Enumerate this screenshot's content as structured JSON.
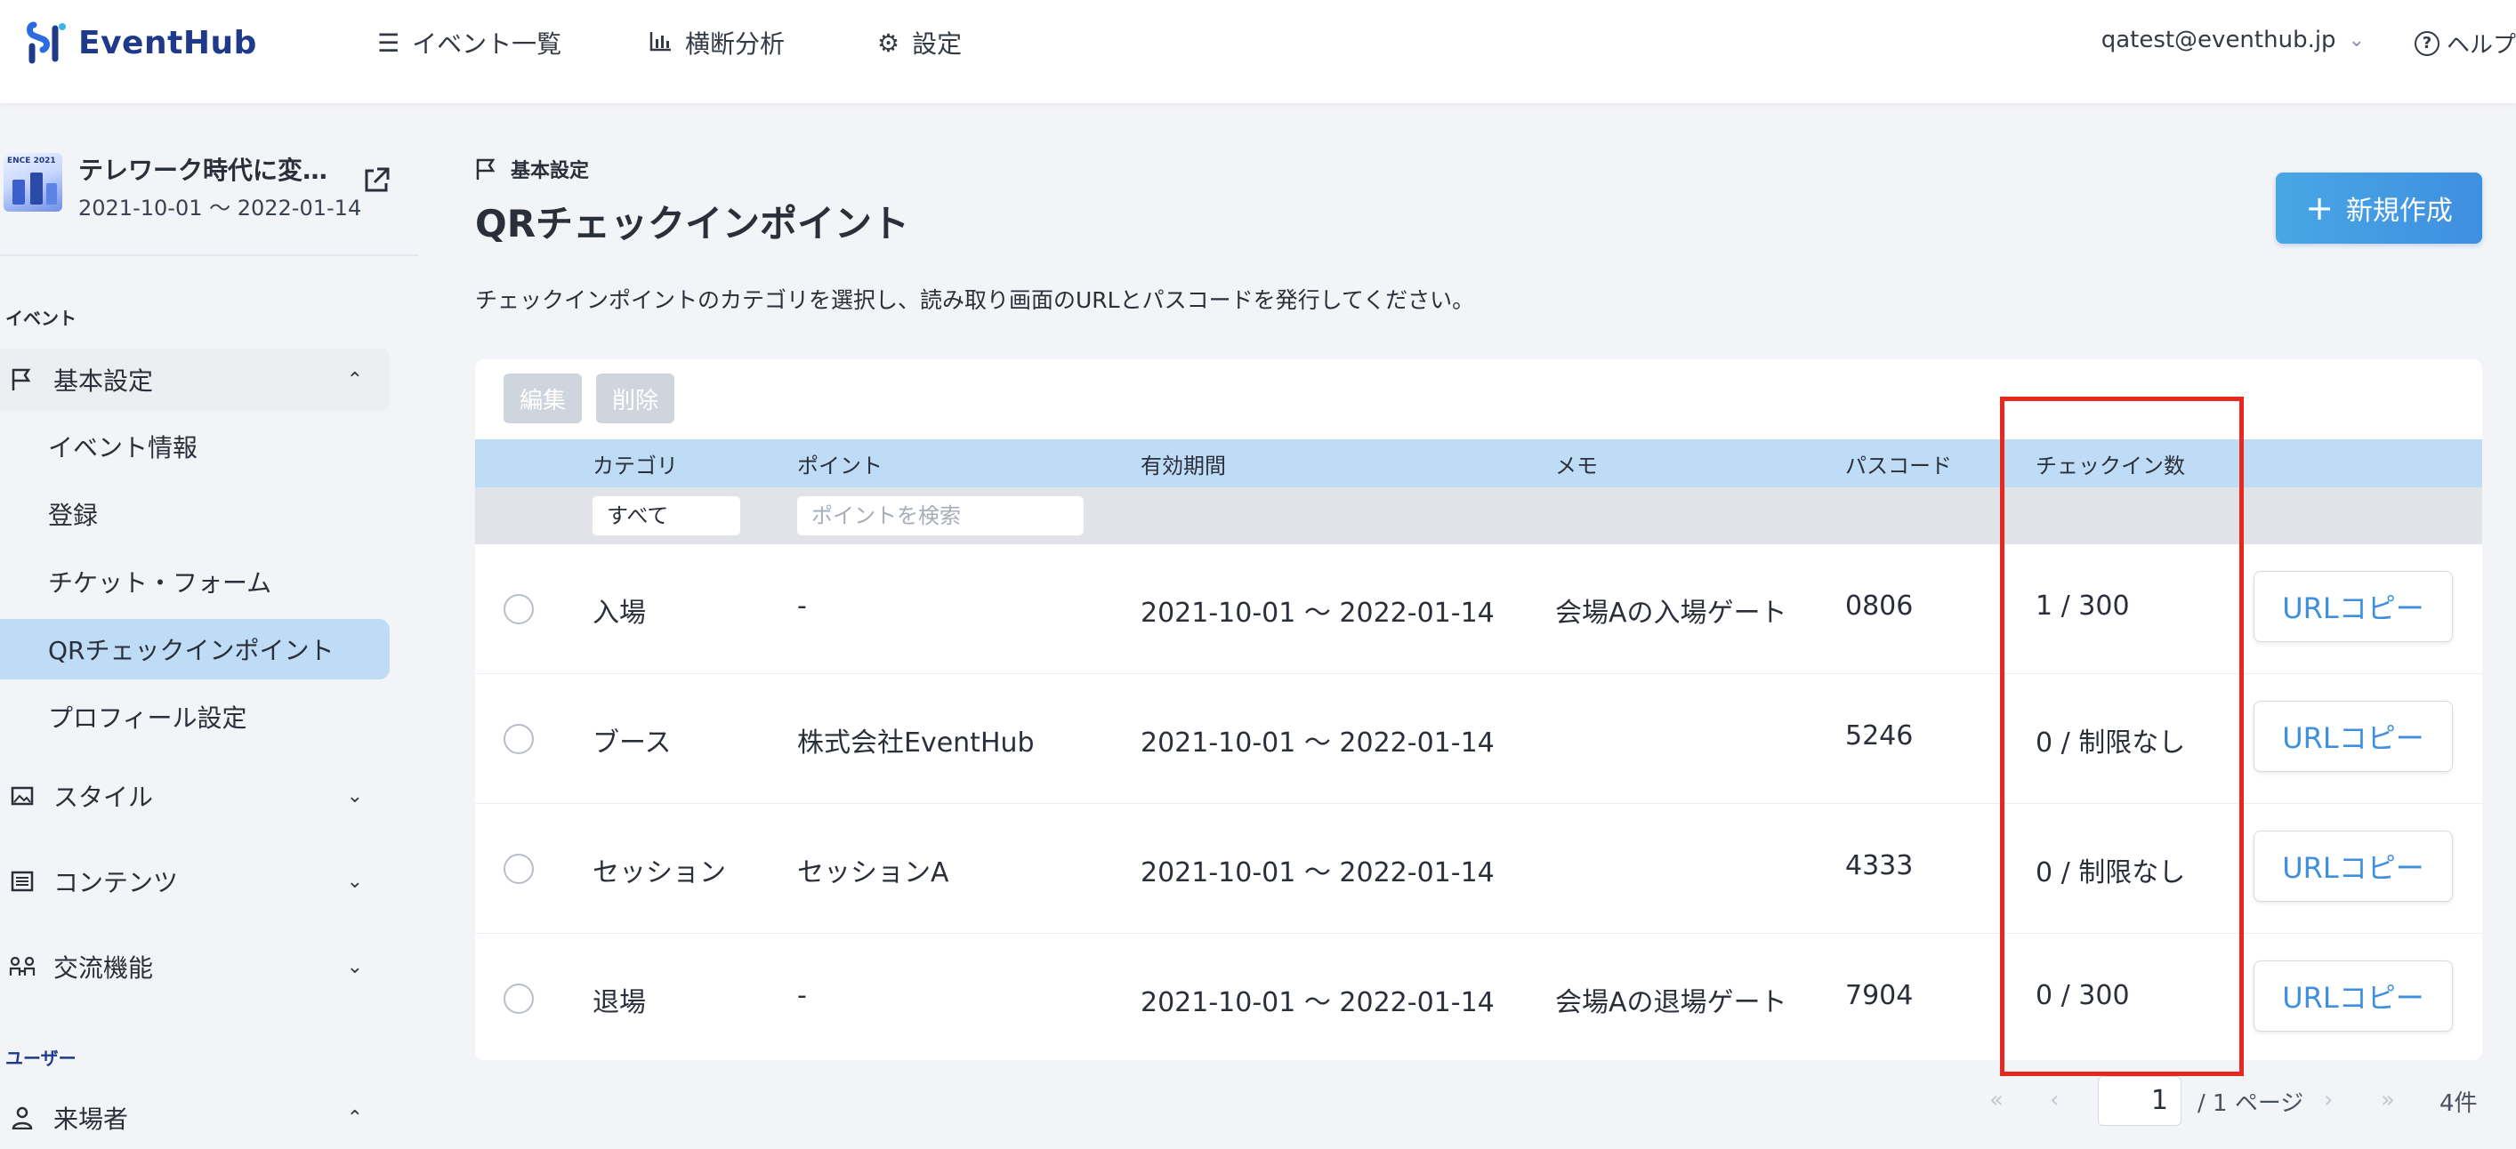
{
  "app": {
    "name": "EventHub"
  },
  "header": {
    "nav": [
      {
        "label": "イベント一覧",
        "icon": "list-icon"
      },
      {
        "label": "横断分析",
        "icon": "bar-chart-icon"
      },
      {
        "label": "設定",
        "icon": "gear-icon"
      }
    ],
    "user_email": "qatest@eventhub.jp",
    "help_label": "ヘルプ"
  },
  "sidebar": {
    "event": {
      "title": "テレワーク時代に変…",
      "dates": "2021-10-01 〜 2022-01-14",
      "thumb_text": "ENCE 2021"
    },
    "section_event": "イベント",
    "basic_settings": "基本設定",
    "sub_items": [
      "イベント情報",
      "登録",
      "チケット・フォーム",
      "QRチェックインポイント",
      "プロフィール設定"
    ],
    "style": "スタイル",
    "contents": "コンテンツ",
    "networking": "交流機能",
    "section_user": "ユーザー",
    "visitors": "来場者"
  },
  "main": {
    "breadcrumb": "基本設定",
    "title": "QRチェックインポイント",
    "description": "チェックインポイントのカテゴリを選択し、読み取り画面のURLとパスコードを発行してください。",
    "new_button": "新規作成",
    "edit_button": "編集",
    "delete_button": "削除",
    "columns": [
      "カテゴリ",
      "ポイント",
      "有効期間",
      "メモ",
      "パスコード",
      "チェックイン数"
    ],
    "filter_category": "すべて",
    "filter_point_placeholder": "ポイントを検索",
    "rows": [
      {
        "category": "入場",
        "point": "-",
        "period": "2021-10-01 〜 2022-01-14",
        "memo": "会場Aの入場ゲート",
        "passcode": "0806",
        "checkins": "1 / 300",
        "copy": "URLコピー"
      },
      {
        "category": "ブース",
        "point": "株式会社EventHub",
        "period": "2021-10-01 〜 2022-01-14",
        "memo": "",
        "passcode": "5246",
        "checkins": "0 / 制限なし",
        "copy": "URLコピー"
      },
      {
        "category": "セッション",
        "point": "セッションA",
        "period": "2021-10-01 〜 2022-01-14",
        "memo": "",
        "passcode": "4333",
        "checkins": "0 / 制限なし",
        "copy": "URLコピー"
      },
      {
        "category": "退場",
        "point": "-",
        "period": "2021-10-01 〜 2022-01-14",
        "memo": "会場Aの退場ゲート",
        "passcode": "7904",
        "checkins": "0 / 300",
        "copy": "URLコピー"
      }
    ]
  },
  "pagination": {
    "current": "1",
    "total": "/ 1 ページ",
    "count": "4件"
  },
  "colors": {
    "accent": "#3f8fe0",
    "header_row": "#bfdcf7",
    "highlight": "#e8281e"
  }
}
